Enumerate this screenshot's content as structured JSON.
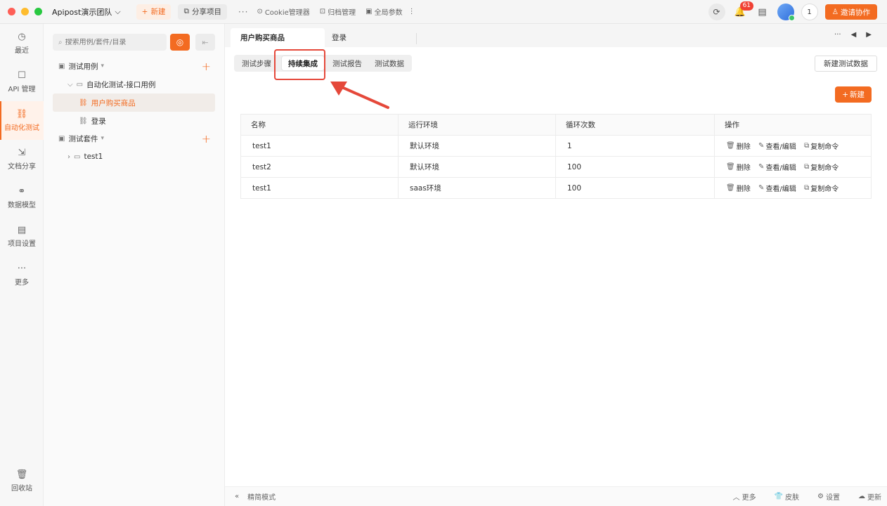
{
  "titlebar": {
    "team": "Apipost演示团队",
    "new_label": "新建",
    "share_label": "分享项目",
    "more": "···",
    "links": [
      "Cookie管理器",
      "归档管理",
      "全局参数"
    ],
    "notifications": "61",
    "member_count": "1",
    "invite_label": "邀请协作"
  },
  "rail": {
    "items": [
      "最近",
      "API 管理",
      "自动化测试",
      "文档分享",
      "数据模型",
      "项目设置",
      "更多"
    ],
    "more_dots": "···",
    "recycle": "回收站"
  },
  "tree": {
    "search_placeholder": "搜索用例/套件/目录",
    "cases_group": "测试用例",
    "folder": "自动化测试-接口用例",
    "case_selected": "用户购买商品",
    "case_login": "登录",
    "suites_group": "测试套件",
    "suite_item": "test1"
  },
  "main": {
    "tabs": [
      "用户购买商品",
      "登录"
    ],
    "tab_tools": "···",
    "subtabs": [
      "测试步骤",
      "持续集成",
      "测试报告",
      "测试数据"
    ],
    "new_test_data": "新建测试数据",
    "add_label": "新建",
    "table": {
      "headers": [
        "名称",
        "运行环境",
        "循环次数",
        "操作"
      ],
      "rows": [
        {
          "name": "test1",
          "env": "默认环境",
          "loops": "1"
        },
        {
          "name": "test2",
          "env": "默认环境",
          "loops": "100"
        },
        {
          "name": "test1",
          "env": "saas环境",
          "loops": "100"
        }
      ],
      "ops": [
        "删除",
        "查看/编辑",
        "复制命令"
      ]
    }
  },
  "footer": {
    "mode": "精简模式",
    "more": "更多",
    "skin": "皮肤",
    "settings": "设置",
    "update": "更新"
  },
  "colors": {
    "accent": "#f36b21",
    "annotation": "#e5483a"
  }
}
